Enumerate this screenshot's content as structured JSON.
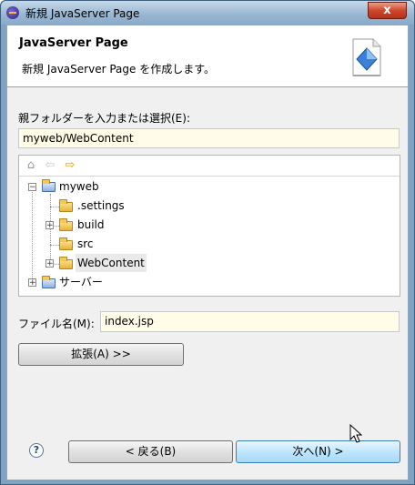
{
  "window": {
    "title": "新規 JavaServer Page",
    "close_label": "x"
  },
  "header": {
    "title": "JavaServer Page",
    "description": "新規 JavaServer Page を作成します。",
    "icon": "jsp-wizard-icon"
  },
  "parent_folder": {
    "label": "親フォルダーを入力または選択(E):",
    "value": "myweb/WebContent"
  },
  "tree_toolbar": {
    "home_icon": "⌂",
    "back_icon": "⇦",
    "forward_icon": "⇨"
  },
  "tree": {
    "items": [
      {
        "label": "myweb",
        "expander": "−",
        "icon": "project-icon"
      },
      {
        "label": ".settings",
        "icon": "folder-icon"
      },
      {
        "label": "build",
        "expander": "+",
        "icon": "folder-icon"
      },
      {
        "label": "src",
        "icon": "folder-icon"
      },
      {
        "label": "WebContent",
        "expander": "+",
        "icon": "folder-icon",
        "selected": true
      },
      {
        "label": "サーバー",
        "expander": "+",
        "icon": "project-icon"
      }
    ]
  },
  "file_name": {
    "label": "ファイル名(M):",
    "value": "index.jsp"
  },
  "advanced_button": {
    "label": "拡張(A) >>"
  },
  "footer": {
    "help_label": "?",
    "back_label": "< 戻る(B)",
    "next_label": "次へ(N) >"
  }
}
